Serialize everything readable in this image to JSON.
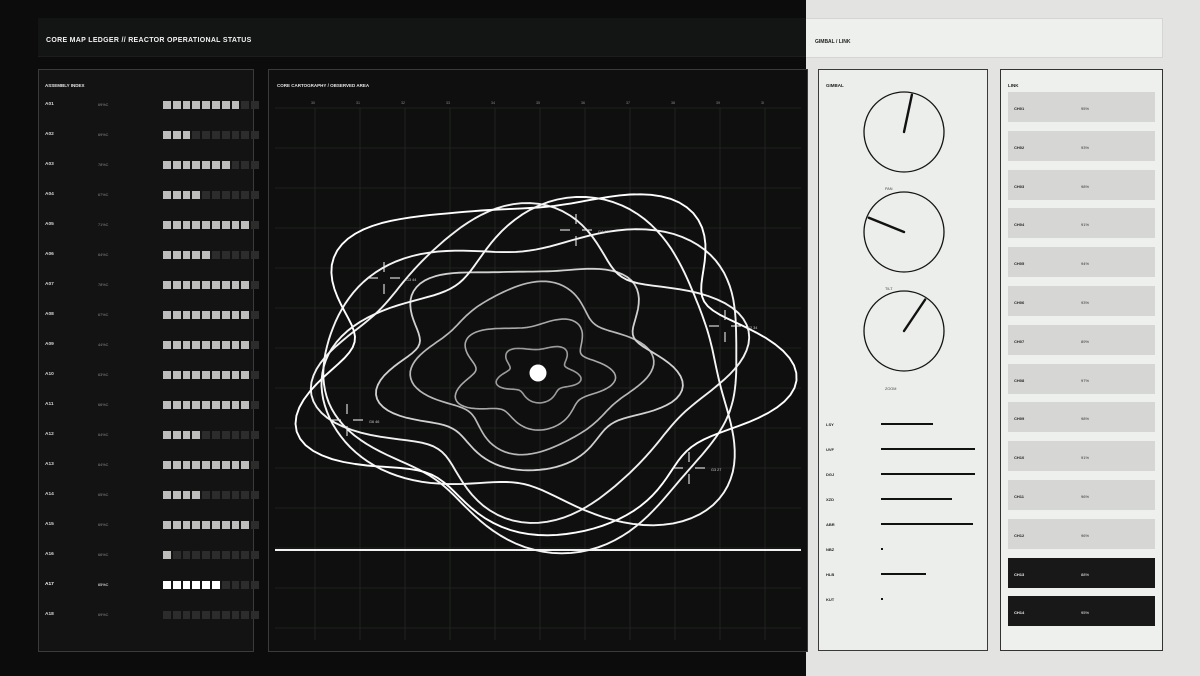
{
  "header": {
    "title": "CORE MAP LEDGER // REACTOR OPERATIONAL STATUS",
    "right_title": "GIMBAL / LINK"
  },
  "assembly": {
    "title": "ASSEMBLY INDEX",
    "rows": [
      {
        "id": "A01",
        "value": "69%C",
        "level": 0.8,
        "highlight": false
      },
      {
        "id": "A02",
        "value": "69%C",
        "level": 0.3,
        "highlight": false
      },
      {
        "id": "A03",
        "value": "78%C",
        "level": 0.7,
        "highlight": false
      },
      {
        "id": "A04",
        "value": "67%C",
        "level": 0.4,
        "highlight": false
      },
      {
        "id": "A05",
        "value": "71%C",
        "level": 0.9,
        "highlight": false
      },
      {
        "id": "A06",
        "value": "64%C",
        "level": 0.5,
        "highlight": false
      },
      {
        "id": "A07",
        "value": "78%C",
        "level": 0.9,
        "highlight": false
      },
      {
        "id": "A08",
        "value": "67%C",
        "level": 0.9,
        "highlight": false
      },
      {
        "id": "A09",
        "value": "44%C",
        "level": 0.9,
        "highlight": false
      },
      {
        "id": "A10",
        "value": "63%C",
        "level": 0.9,
        "highlight": false
      },
      {
        "id": "A11",
        "value": "66%C",
        "level": 0.9,
        "highlight": false
      },
      {
        "id": "A12",
        "value": "64%C",
        "level": 0.4,
        "highlight": false
      },
      {
        "id": "A13",
        "value": "64%C",
        "level": 0.9,
        "highlight": false
      },
      {
        "id": "A14",
        "value": "65%C",
        "level": 0.4,
        "highlight": false
      },
      {
        "id": "A15",
        "value": "69%C",
        "level": 0.9,
        "highlight": false
      },
      {
        "id": "A16",
        "value": "66%C",
        "level": 0.1,
        "highlight": false
      },
      {
        "id": "A17",
        "value": "65%C",
        "level": 0.6,
        "highlight": true
      },
      {
        "id": "A18",
        "value": "69%C",
        "level": 0.0,
        "highlight": false
      }
    ]
  },
  "cartography": {
    "title": "CORE CARTOGRAPHY / OBSERVED AREA",
    "ticks": [
      "30",
      "31",
      "32",
      "33",
      "34",
      "35",
      "36",
      "37",
      "38",
      "39",
      "3I"
    ],
    "markers": [
      "G3 44",
      "G4 48",
      "G2 34",
      "G6 46",
      "G3 27"
    ]
  },
  "gimbal": {
    "title": "GIMBAL",
    "dials": [
      {
        "label": "PAN",
        "angle_deg": 12
      },
      {
        "label": "TILT",
        "angle_deg": -68
      },
      {
        "label": "ZOOM",
        "angle_deg": 34
      }
    ],
    "meters": [
      {
        "label": "LSY",
        "level": 0.55
      },
      {
        "label": "UVF",
        "level": 1.0
      },
      {
        "label": "DGJ",
        "level": 1.0
      },
      {
        "label": "XZD",
        "level": 0.75
      },
      {
        "label": "ABR",
        "level": 0.98
      },
      {
        "label": "NBZ",
        "level": 0.02
      },
      {
        "label": "HLB",
        "level": 0.48
      },
      {
        "label": "KUT",
        "level": 0.02
      }
    ]
  },
  "link": {
    "title": "LINK",
    "channels": [
      {
        "name": "CH01",
        "pct": "95%",
        "active": false
      },
      {
        "name": "CH02",
        "pct": "93%",
        "active": false
      },
      {
        "name": "CH03",
        "pct": "98%",
        "active": false
      },
      {
        "name": "CH04",
        "pct": "91%",
        "active": false
      },
      {
        "name": "CH05",
        "pct": "94%",
        "active": false
      },
      {
        "name": "CH06",
        "pct": "93%",
        "active": false
      },
      {
        "name": "CH07",
        "pct": "89%",
        "active": false
      },
      {
        "name": "CH08",
        "pct": "97%",
        "active": false
      },
      {
        "name": "CH09",
        "pct": "98%",
        "active": false
      },
      {
        "name": "CH10",
        "pct": "91%",
        "active": false
      },
      {
        "name": "CH11",
        "pct": "96%",
        "active": false
      },
      {
        "name": "CH12",
        "pct": "96%",
        "active": false
      },
      {
        "name": "CH13",
        "pct": "88%",
        "active": true
      },
      {
        "name": "CH14",
        "pct": "95%",
        "active": true
      }
    ]
  }
}
